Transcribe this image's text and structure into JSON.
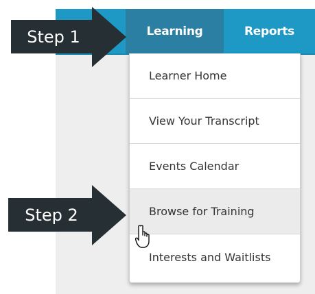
{
  "nav": {
    "tabs": [
      {
        "label": "Learning",
        "active": true
      },
      {
        "label": "Reports",
        "active": false
      }
    ]
  },
  "dropdown": {
    "items": [
      {
        "label": "Learner Home"
      },
      {
        "label": "View Your Transcript"
      },
      {
        "label": "Events Calendar"
      },
      {
        "label": "Browse for Training",
        "hovered": true
      },
      {
        "label": "Interests and Waitlists"
      }
    ]
  },
  "callouts": {
    "step1": "Step 1",
    "step2": "Step 2"
  },
  "colors": {
    "navbar": "#1e98c4",
    "active_tab": "#2b7fa3",
    "callout": "#262f33",
    "hover_item": "#ebebeb"
  },
  "icons": {
    "cursor": "hand-pointer-icon"
  }
}
